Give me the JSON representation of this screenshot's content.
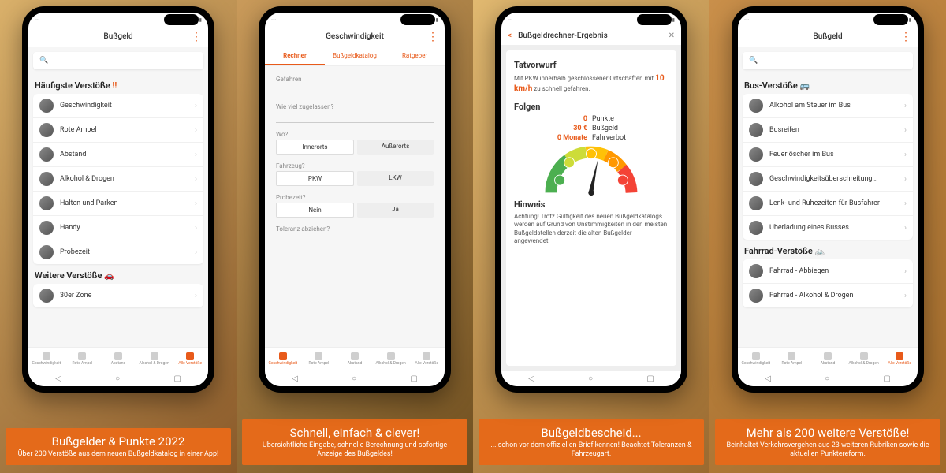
{
  "panels": [
    {
      "caption_title": "Bußgelder & Punkte 2022",
      "caption_sub": "Über 200 Verstöße aus dem neuen Bußgeldkatalog in einer App!",
      "topbar_title": "Bußgeld",
      "section1_title": "Häufigste Verstöße",
      "section1_mark": "!!",
      "list1": [
        "Geschwindigkeit",
        "Rote Ampel",
        "Abstand",
        "Alkohol & Drogen",
        "Halten und Parken",
        "Handy",
        "Probezeit"
      ],
      "section2_title": "Weitere Verstöße",
      "section2_emoji": "🚗",
      "list2": [
        "30er Zone"
      ]
    },
    {
      "caption_title": "Schnell, einfach & clever!",
      "caption_sub": "Übersichtliche Eingabe, schnelle Berechnung und sofortige Anzeige des Bußgeldes!",
      "topbar_title": "Geschwindigkeit",
      "tabs": [
        "Rechner",
        "Bußgeldkatalog",
        "Ratgeber"
      ],
      "form": {
        "f1": "Gefahren",
        "f2": "Wie viel zugelassen?",
        "f3": "Wo?",
        "f3a": "Innerorts",
        "f3b": "Außerorts",
        "f4": "Fahrzeug?",
        "f4a": "PKW",
        "f4b": "LKW",
        "f5": "Probezeit?",
        "f5a": "Nein",
        "f5b": "Ja",
        "f6": "Toleranz abziehen?"
      }
    },
    {
      "caption_title": "Bußgeldbescheid...",
      "caption_sub": "... schon vor dem offiziellen Brief kennen! Beachtet Toleranzen & Fahrzeugart.",
      "result_title": "Bußgeldrechner-Ergebnis",
      "r_sec1": "Tatvorwurf",
      "r_text1a": "Mit PKW innerhalb geschlossener Ortschaften mit ",
      "r_speed": "10 km/h",
      "r_text1b": " zu schnell gefahren.",
      "r_sec2": "Folgen",
      "kv": [
        {
          "v": "0",
          "k": "Punkte"
        },
        {
          "v": "30 €",
          "k": "Bußgeld"
        },
        {
          "v": "0 Monate",
          "k": "Fahrverbot"
        }
      ],
      "r_sec3": "Hinweis",
      "r_text3": "Achtung! Trotz Gültigkeit des neuen Bußgeldkatalogs werden auf Grund von Unstimmigkeiten in den meisten Bußgeldstellen derzeit die alten Bußgelder angewendet."
    },
    {
      "caption_title": "Mehr als 200 weitere Verstöße!",
      "caption_sub": "Beinhaltet Verkehrsvergehen aus 23 weiteren Rubriken sowie die aktuellen Punktereform.",
      "topbar_title": "Bußgeld",
      "sectionA_title": "Bus-Verstöße",
      "sectionA_emoji": "🚌",
      "listA": [
        "Alkohol am Steuer im Bus",
        "Busreifen",
        "Feuerlöscher im Bus",
        "Geschwindigkeitsüberschreitung...",
        "Lenk- und Ruhezeiten für Busfahrer",
        "Überladung eines Busses"
      ],
      "sectionB_title": "Fahrrad-Verstöße",
      "sectionB_emoji": "🚲",
      "listB": [
        "Fahrrad - Abbiegen",
        "Fahrrad - Alkohol & Drogen"
      ]
    }
  ],
  "bottomnav": [
    "Geschwindigkeit",
    "Rote Ampel",
    "Abstand",
    "Alkohol & Drogen",
    "Alle Verstöße"
  ]
}
